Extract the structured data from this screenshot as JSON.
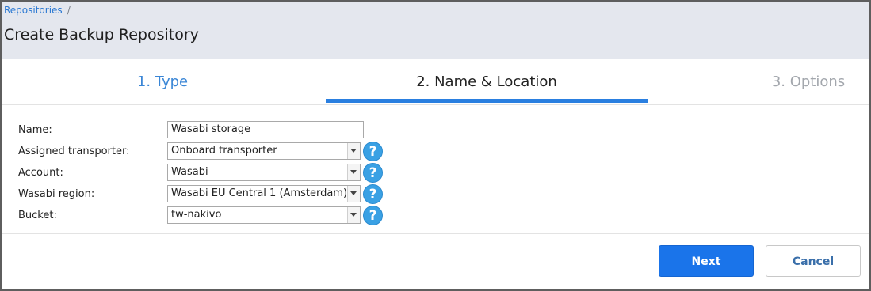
{
  "breadcrumb": {
    "root": "Repositories",
    "separator": "/"
  },
  "title": "Create Backup Repository",
  "steps": [
    {
      "label": "1. Type",
      "state": "done"
    },
    {
      "label": "2. Name & Location",
      "state": "active"
    },
    {
      "label": "3. Options",
      "state": "pending"
    }
  ],
  "form": {
    "name": {
      "label": "Name:",
      "value": "Wasabi storage"
    },
    "transporter": {
      "label": "Assigned transporter:",
      "value": "Onboard transporter"
    },
    "account": {
      "label": "Account:",
      "value": "Wasabi"
    },
    "region": {
      "label": "Wasabi region:",
      "value": "Wasabi EU Central 1 (Amsterdam)"
    },
    "bucket": {
      "label": "Bucket:",
      "value": "tw-nakivo"
    }
  },
  "help_icon": "?",
  "buttons": {
    "next": "Next",
    "cancel": "Cancel"
  },
  "colors": {
    "accent": "#1a74ea",
    "step_done": "#3a86d6",
    "help": "#3aa1e4",
    "header_bg": "#e4e7ee"
  }
}
